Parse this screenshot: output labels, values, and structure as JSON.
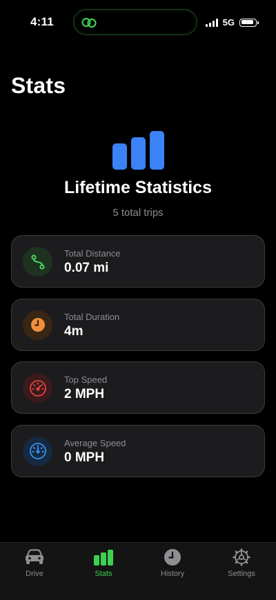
{
  "status_bar": {
    "time": "4:11",
    "network": "5G",
    "battery_level": 0.9
  },
  "page": {
    "title": "Stats"
  },
  "hero": {
    "icon": "bar-chart-icon",
    "title": "Lifetime Statistics",
    "subtitle": "5 total trips"
  },
  "stats": [
    {
      "label": "Total Distance",
      "value": "0.07 mi",
      "icon": "route-icon",
      "color": "#4cd964",
      "bg": "#1d3320"
    },
    {
      "label": "Total Duration",
      "value": "4m",
      "icon": "clock-icon",
      "color": "#f0903a",
      "bg": "#3a2615"
    },
    {
      "label": "Top Speed",
      "value": "2 MPH",
      "icon": "speedometer-icon",
      "color": "#e0443e",
      "bg": "#3a1a1b"
    },
    {
      "label": "Average Speed",
      "value": "0 MPH",
      "icon": "gauge-icon",
      "color": "#3a8ff0",
      "bg": "#152a40"
    }
  ],
  "tabs": [
    {
      "label": "Drive",
      "icon": "car-icon",
      "active": false
    },
    {
      "label": "Stats",
      "icon": "bar-chart-icon",
      "active": true
    },
    {
      "label": "History",
      "icon": "clock-icon",
      "active": false
    },
    {
      "label": "Settings",
      "icon": "gear-icon",
      "active": false
    }
  ],
  "colors": {
    "accent_blue": "#3b82f6",
    "accent_green": "#3ecf4f",
    "card_bg": "#1c1c1e",
    "muted_text": "#8e8e93"
  }
}
